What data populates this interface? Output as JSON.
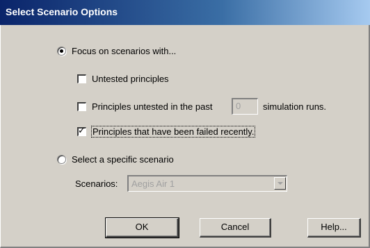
{
  "dialog": {
    "title": "Select Scenario Options"
  },
  "options": {
    "focus_radio_label": "Focus on scenarios with...",
    "focus_radio_selected": true,
    "untested_label": "Untested principles",
    "untested_checked": false,
    "untested_past_label": "Principles untested in the past",
    "untested_past_checked": false,
    "untested_past_value": "0",
    "sim_runs_label": "simulation runs.",
    "failed_recently_label": "Principles that have been failed recently.",
    "failed_recently_checked": true,
    "specific_radio_label": "Select a specific scenario",
    "specific_radio_selected": false,
    "scenarios_label": "Scenarios:",
    "scenarios_selected": "Aegis Air 1"
  },
  "buttons": {
    "ok_label": "OK",
    "cancel_label": "Cancel",
    "help_label": "Help..."
  }
}
